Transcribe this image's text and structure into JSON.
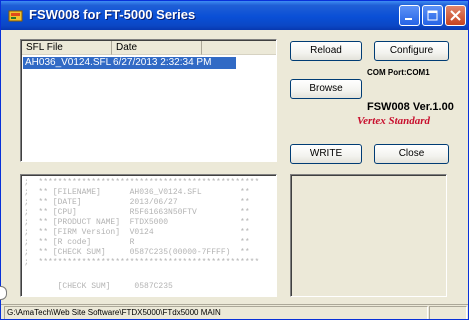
{
  "window": {
    "title": "FSW008 for FT-5000 Series",
    "icons": {
      "app": "app-icon",
      "minimize": "minimize-icon",
      "maximize": "maximize-icon",
      "close": "close-icon"
    }
  },
  "file_list": {
    "columns": [
      "SFL File",
      "Date"
    ],
    "rows": [
      {
        "file": "AH036_V0124.SFL",
        "date": "6/27/2013 2:32:34 PM",
        "selected": true
      }
    ]
  },
  "buttons": {
    "reload": "Reload",
    "configure": "Configure",
    "browse": "Browse",
    "write": "WRITE",
    "close": "Close"
  },
  "com_port": "COM Port:COM1",
  "version": "FSW008 Ver.1.00",
  "brand": "Vertex Standard",
  "memo_lines": [
    ";  **********************************************",
    ";  ** [FILENAME]      AH036_V0124.SFL        **",
    ";  ** [DATE]          2013/06/27             **",
    ";  ** [CPU]           R5F61663N50FTV         **",
    ";  ** [PRODUCT NAME]  FTDX5000               **",
    ";  ** [FIRM Version]  V0124                  **",
    ";  ** [R code]        R                      **",
    ";  ** [CHECK SUM]     0587C235(00000-7FFFF)  **",
    ";  **********************************************",
    "",
    "       [CHECK SUM]     0587C235"
  ],
  "status_text": "G:\\AmaTech\\Web Site Software\\FTDX5000\\FTdx5000 MAIN",
  "colors": {
    "title_bar": "#0a4fd6",
    "selection": "#316ac5",
    "brand": "#c8102e",
    "window_bg": "#ece9d8"
  }
}
